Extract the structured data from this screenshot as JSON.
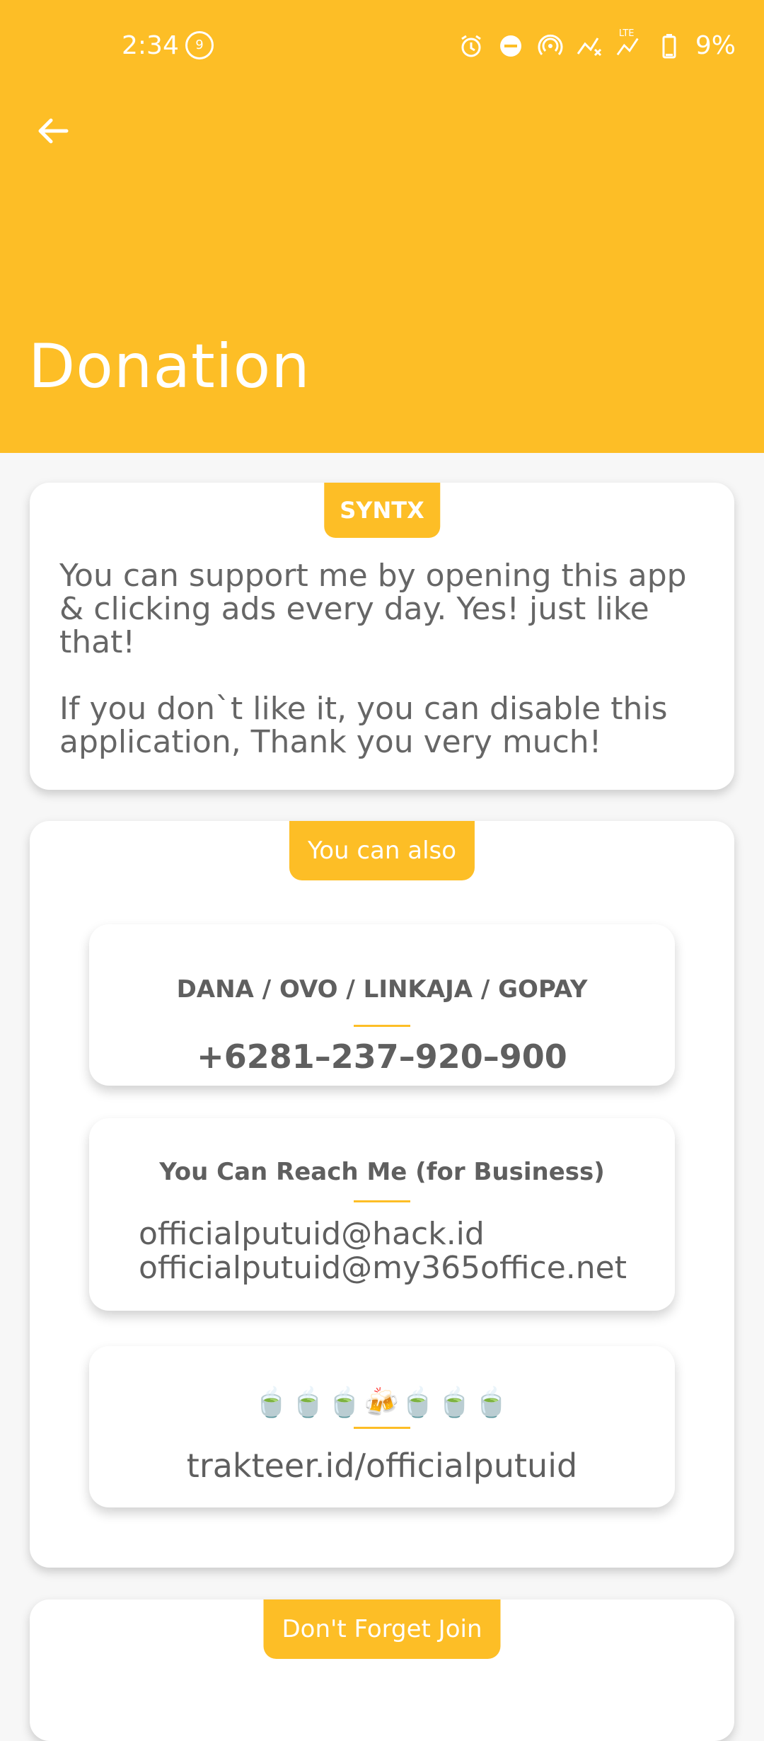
{
  "status_bar": {
    "time": "2:34",
    "notification_count": "9",
    "battery": "9%",
    "network_label": "LTE"
  },
  "header": {
    "title": "Donation"
  },
  "card_syntx": {
    "tag": "SYNTX",
    "paragraph_1": "You can support me by opening this app & clicking ads every day. Yes! just like that!",
    "paragraph_2": "If you don`t like it, you can disable this application, Thank you very much!"
  },
  "card_also": {
    "tag": "You can also",
    "payment": {
      "title": "DANA / OVO / LINKAJA / GOPAY",
      "phone": "+6281–237–920–900"
    },
    "business": {
      "title": "You Can Reach Me (for Business)",
      "email_1": "officialputuid@hack.id",
      "email_2": "officialputuid@my365office.net"
    },
    "trakteer": {
      "emoji": "🍵🍵🍵🍻🍵🍵🍵",
      "link": "trakteer.id/officialputuid"
    }
  },
  "card_join": {
    "tag": "Don't Forget Join"
  },
  "colors": {
    "accent": "#FDBE26",
    "card": "#FFFFFF",
    "text": "#5F5F5F",
    "background": "#F7F7F7"
  }
}
